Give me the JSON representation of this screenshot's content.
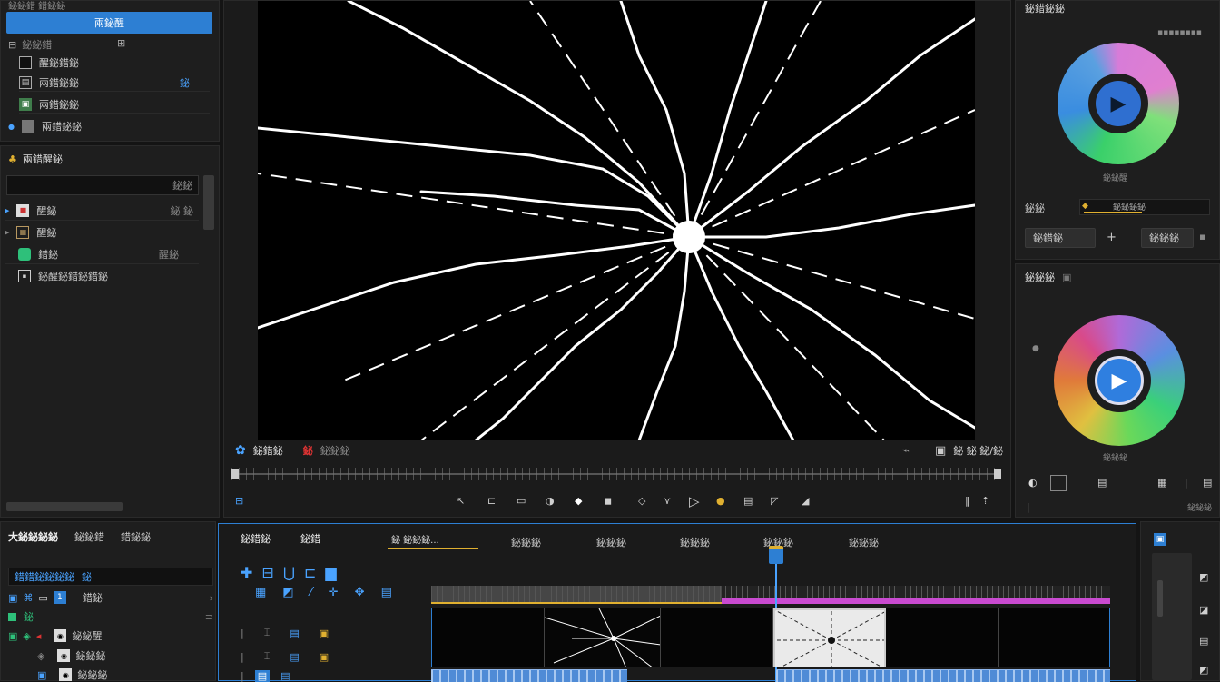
{
  "app": {
    "accent": "#2d7fd3",
    "timeline_accent": "#c94ad0",
    "playhead_color": "#4aa3ff"
  },
  "left_top": {
    "header_label": "鉍鉍錯 錯鉍鉍",
    "primary_button": "兩鉍醒",
    "tree_header": "鉍鉍錯",
    "tree_header_icon": "⊞",
    "items": [
      {
        "label": "醒鉍錯鉍",
        "icon": "square-icon"
      },
      {
        "label": "兩錯鉍鉍",
        "icon": "document-icon",
        "tag": "鉍"
      },
      {
        "label": "兩錯鉍鉍",
        "icon": "image-icon"
      },
      {
        "label": "兩錯鉍鉍",
        "icon": "thumbnail-icon"
      }
    ]
  },
  "left_mid": {
    "title": "兩錯醒鉍",
    "search_placeholder": "",
    "search_badge": "鉍鉍",
    "items": [
      {
        "label": "醒鉍",
        "meta": "鉍 鉍"
      },
      {
        "label": "醒鉍",
        "meta": ""
      },
      {
        "label": "錯鉍",
        "meta": "醒鉍"
      },
      {
        "label": "鉍醒鉍錯鉍錯鉍",
        "meta": ""
      }
    ]
  },
  "viewer": {
    "label_left": "鉍錯鉍",
    "label_rec": "鉍",
    "label_rec_text": "鉍鉍鉍",
    "label_right": "鉍 鉍 鉍/鉍",
    "controls": [
      "⊟",
      "↖",
      "⊏",
      "▭",
      "◑",
      "◆",
      "◼",
      "◇",
      "⋎",
      "▷",
      "●",
      "▤",
      "◸",
      "◢"
    ]
  },
  "right_top": {
    "title": "鉍錯鉍鉍",
    "wheel1_caption": "鉍鉍醒",
    "slider_label": "鉍鉍",
    "slider_value": "鉍鉍鉍鉍",
    "field1": "鉍錯鉍",
    "plus": "+",
    "field2": "鉍鉍鉍"
  },
  "right_mid": {
    "title": "鉍鉍鉍",
    "wheel2_caption": "鉍鉍鉍",
    "bottom_label": "鉍鉍鉍"
  },
  "timeline_left": {
    "title": "大鉍鉍鉍鉍",
    "tab2": "鉍鉍錯",
    "tab3": "錯鉍鉍",
    "field": "錯錯鉍鉍鉍鉍",
    "field_tag": "鉍",
    "row2_label": "錯鉍",
    "row3_label": "鉍",
    "track1": "鉍鉍醒",
    "track2": "鉍鉍鉍",
    "track3": "鉍鉍鉍"
  },
  "timeline": {
    "tabs": [
      "鉍錯鉍",
      "鉍錯",
      "鉍鉍鉍",
      "鉍鉍鉍",
      "鉍鉍鉍",
      "鉍鉍鉍",
      "鉍鉍鉍"
    ],
    "active_tab": "鉍 鉍鉍鉍..."
  }
}
